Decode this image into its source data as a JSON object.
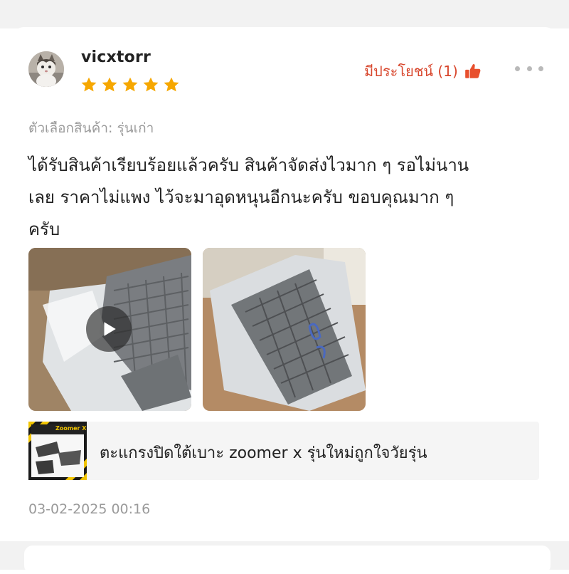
{
  "review": {
    "username": "vicxtorr",
    "rating": 5,
    "helpful_label": "มีประโยชน์ (1)",
    "variant_label": "ตัวเลือกสินค้า: รุ่นเก่า",
    "body_lines": [
      "ได้รับสินค้าเรียบร้อยแล้วครับ สินค้าจัดส่งไวมาก ๆ รอไม่นาน",
      "เลย ราคาไม่แพง ไว้จะมาอุดหนุนอีกนะครับ ขอบคุณมาก ๆ",
      "ครับ"
    ],
    "media": [
      {
        "kind": "video",
        "icon": "play-icon"
      },
      {
        "kind": "photo"
      }
    ],
    "product": {
      "name": "ตะแกรงปิดใต้เบาะ zoomer x รุ่นใหม่ถูกใจวัยรุ่น",
      "thumb_text": "Zoomer X"
    },
    "timestamp": "03-02-2025 00:16"
  },
  "colors": {
    "accent": "#d8462c",
    "star": "#f6a700",
    "muted": "#9a9a9a"
  }
}
